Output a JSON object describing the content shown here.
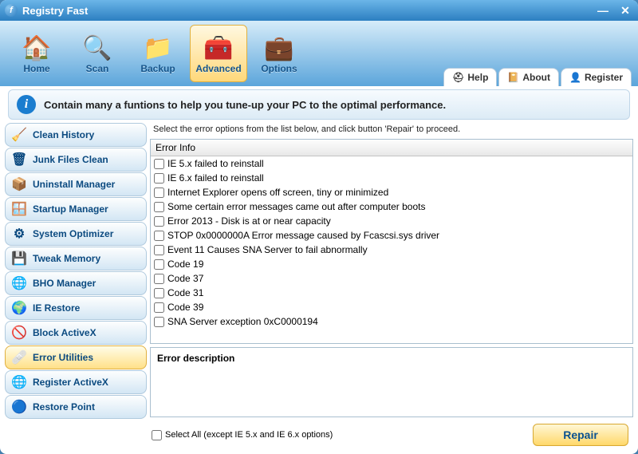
{
  "app": {
    "title": "Registry Fast"
  },
  "toolbar": {
    "items": [
      {
        "label": "Home",
        "icon": "🏠"
      },
      {
        "label": "Scan",
        "icon": "🔍"
      },
      {
        "label": "Backup",
        "icon": "📁"
      },
      {
        "label": "Advanced",
        "icon": "🧰",
        "selected": true
      },
      {
        "label": "Options",
        "icon": "💼"
      }
    ],
    "right": [
      {
        "label": "Help",
        "icon": "⛑"
      },
      {
        "label": "About",
        "icon": "📔"
      },
      {
        "label": "Register",
        "icon": "👤"
      }
    ]
  },
  "banner": {
    "text": "Contain many a funtions to help you tune-up your PC to the optimal performance."
  },
  "sidebar": {
    "items": [
      {
        "label": "Clean History",
        "icon": "🧹"
      },
      {
        "label": "Junk Files Clean",
        "icon": "🗑"
      },
      {
        "label": "Uninstall Manager",
        "icon": "📦"
      },
      {
        "label": "Startup Manager",
        "icon": "🪟"
      },
      {
        "label": "System Optimizer",
        "icon": "⚙"
      },
      {
        "label": "Tweak Memory",
        "icon": "💾"
      },
      {
        "label": "BHO Manager",
        "icon": "🌐"
      },
      {
        "label": "IE Restore",
        "icon": "🌍"
      },
      {
        "label": "Block ActiveX",
        "icon": "🚫"
      },
      {
        "label": "Error Utilities",
        "icon": "🩹",
        "selected": true
      },
      {
        "label": "Register ActiveX",
        "icon": "🌐"
      },
      {
        "label": "Restore Point",
        "icon": "🔵"
      }
    ]
  },
  "main": {
    "instruction": "Select the error options from the list below, and click button 'Repair' to proceed.",
    "header": "Error Info",
    "errors": [
      "IE 5.x failed to reinstall",
      "IE 6.x failed to reinstall",
      "Internet Explorer opens off screen, tiny or minimized",
      "Some certain error messages came out after computer boots",
      "Error 2013 - Disk is at or near capacity",
      "STOP 0x0000000A Error message caused by Fcascsi.sys driver",
      "Event 11 Causes SNA Server to fail abnormally",
      "Code 19",
      "Code 37",
      "Code 31",
      "Code 39",
      "SNA Server exception 0xC0000194"
    ],
    "desc_label": "Error description",
    "select_all_label": "Select All  (except IE 5.x and IE 6.x options)",
    "repair_label": "Repair"
  }
}
